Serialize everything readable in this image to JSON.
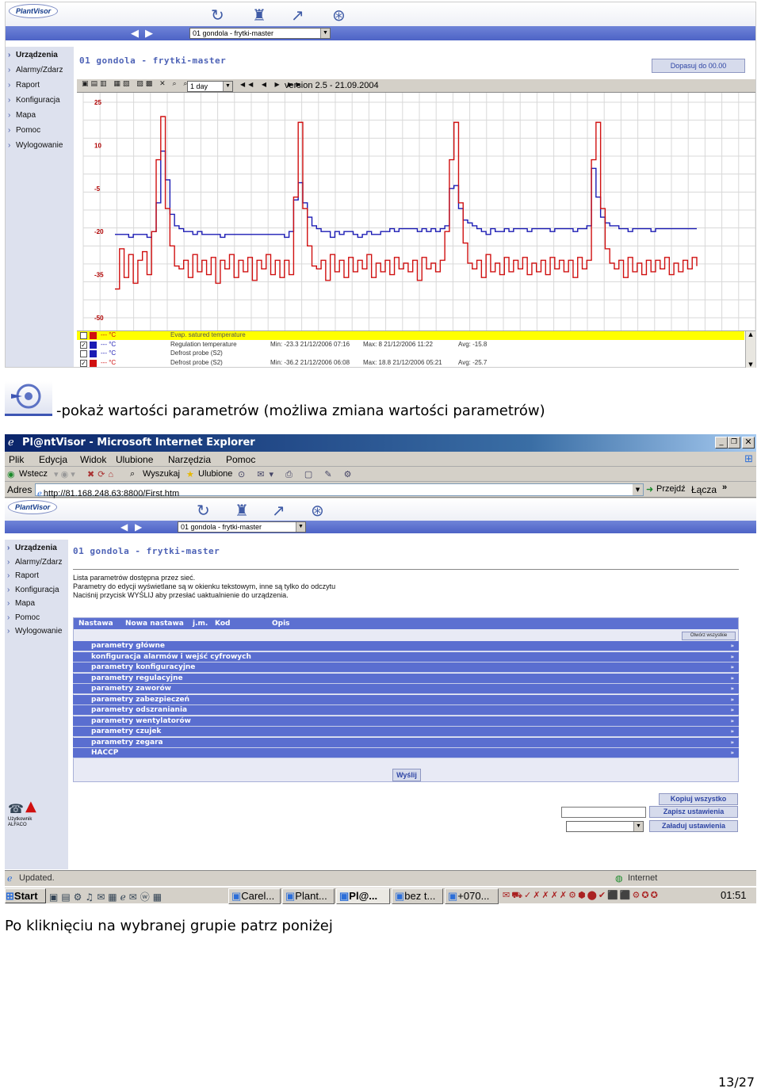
{
  "top_app": {
    "logo": "PlantVisor",
    "device_select": "01 gondola - frytki-master",
    "sidebar": [
      "Urządzenia",
      "Alarmy/Zdarz",
      "Raport",
      "Konfiguracja",
      "Mapa",
      "Pomoc",
      "Wylogowanie"
    ],
    "page_title": "01 gondola - frytki-master",
    "adjust_button": "Dopasuj do 00.00",
    "period_select": "1 day",
    "version": "version 2.5 - 21.09.2004",
    "chart_data": {
      "type": "line",
      "y_ticks": [
        "25",
        "10",
        "-5",
        "-20",
        "-35",
        "-50"
      ],
      "ylim": [
        -50,
        25
      ],
      "grid": true,
      "series": [
        {
          "name": "Regulation temperature",
          "color": "#1b1bb4",
          "values": [
            -21,
            -21,
            -21,
            -22,
            -21,
            -21,
            -21,
            -22,
            -20,
            -10,
            8,
            -2,
            -14,
            -18,
            -19,
            -20,
            -20,
            -21,
            -20,
            -21,
            -21,
            -21,
            -21,
            -22,
            -21,
            -21,
            -21,
            -21,
            -21,
            -21,
            -21,
            -21,
            -21,
            -21,
            -21,
            -21,
            -21,
            -22,
            -20,
            -9,
            -3,
            -10,
            -15,
            -18,
            -19,
            -20,
            -20,
            -22,
            -20,
            -21,
            -20,
            -20,
            -21,
            -22,
            -21,
            -20,
            -21,
            -21,
            -20,
            -20,
            -19,
            -20,
            -19,
            -19,
            -19,
            -19,
            -20,
            -19,
            -20,
            -19,
            -20,
            -19,
            -18,
            -5,
            -4,
            -12,
            -16,
            -17,
            -18,
            -19,
            -20,
            -21,
            -19,
            -20,
            -20,
            -19,
            -20,
            -19,
            -19,
            -19,
            -20,
            -19,
            -19,
            -19,
            -19,
            -20,
            -19,
            -19,
            -19,
            -19,
            -20,
            -19,
            -19,
            -18,
            2,
            -8,
            -15,
            -17,
            -18,
            -18,
            -19,
            -19,
            -20,
            -19,
            -19,
            -19,
            -19,
            -20,
            -19,
            -19,
            -19,
            -19,
            -19,
            -19,
            -19,
            -19,
            -19,
            -19
          ]
        },
        {
          "name": "Defrost probe (S2)",
          "color": "#d01010",
          "values": [
            -40,
            -26,
            -36,
            -28,
            -38,
            -30,
            -27,
            -35,
            -20,
            5,
            20,
            -12,
            -25,
            -32,
            -33,
            -30,
            -36,
            -28,
            -34,
            -30,
            -35,
            -29,
            -38,
            -30,
            -33,
            -28,
            -36,
            -30,
            -34,
            -29,
            -37,
            -30,
            -33,
            -28,
            -35,
            -30,
            -36,
            -30,
            -35,
            -8,
            18,
            -12,
            -25,
            -32,
            -33,
            -30,
            -37,
            -28,
            -34,
            -30,
            -36,
            -29,
            -34,
            -30,
            -33,
            -28,
            -36,
            -31,
            -34,
            -30,
            -35,
            -29,
            -33,
            -31,
            -34,
            -30,
            -37,
            -29,
            -33,
            -31,
            -34,
            -30,
            -20,
            5,
            18,
            -10,
            -24,
            -31,
            -33,
            -30,
            -36,
            -28,
            -34,
            -31,
            -35,
            -29,
            -34,
            -30,
            -33,
            -29,
            -35,
            -31,
            -34,
            -30,
            -35,
            -29,
            -33,
            -30,
            -34,
            -30,
            -36,
            -29,
            -33,
            -30,
            5,
            18,
            -12,
            -26,
            -31,
            -33,
            -30,
            -36,
            -29,
            -34,
            -31,
            -35,
            -30,
            -34,
            -30,
            -33,
            -29,
            -35,
            -31,
            -34,
            -30,
            -33,
            -29,
            -32
          ]
        }
      ]
    },
    "legend": [
      {
        "unit": "--- °C",
        "name": "Evap. satured temperature",
        "color": "#d01010",
        "checked": false,
        "highlight": true,
        "min": "",
        "max": "",
        "avg": ""
      },
      {
        "unit": "--- °C",
        "name": "Regulation temperature",
        "color": "#1b1bb4",
        "checked": true,
        "highlight": false,
        "min": "Min: -23.3   21/12/2006 07:16",
        "max": "Max: 8   21/12/2006 11:22",
        "avg": "Avg: -15.8"
      },
      {
        "unit": "--- °C",
        "name": "Defrost probe (S2)",
        "color": "#1b1bb4",
        "checked": false,
        "highlight": false,
        "min": "",
        "max": "",
        "avg": ""
      },
      {
        "unit": "--- °C",
        "name": "Defrost probe (S2)",
        "color": "#d01010",
        "checked": true,
        "highlight": false,
        "min": "Min: -36.2   21/12/2006 06:08",
        "max": "Max: 18.8   21/12/2006 05:21",
        "avg": "Avg: -25.7"
      }
    ]
  },
  "caption1": "-pokaż wartości parametrów (możliwa zmiana wartości parametrów)",
  "browser": {
    "title": "Pl@ntVisor - Microsoft Internet Explorer",
    "menu": [
      "Plik",
      "Edycja",
      "Widok",
      "Ulubione",
      "Narzędzia",
      "Pomoc"
    ],
    "back": "Wstecz",
    "search": "Wyszukaj",
    "favorites": "Ulubione",
    "address_label": "Adres",
    "address": "http://81.168.248.63:8800/First.htm",
    "go": "Przejdź",
    "links": "Łącza",
    "status": "Updated.",
    "zone": "Internet"
  },
  "param_page": {
    "device_select": "01 gondola - frytki-master",
    "title": "01 gondola - frytki-master",
    "desc": [
      "Lista parametrów dostępna przez sieć.",
      "Parametry do edycji wyświetlane są w okienku tekstowym, inne są tylko do odczytu",
      "Naciśnij przycisk WYŚLIJ aby przesłać uaktualnienie do urządzenia."
    ],
    "columns": [
      "Nastawa",
      "Nowa nastawa",
      "j.m.",
      "Kod",
      "Opis"
    ],
    "open_all": "Otwórz wszystkie",
    "groups": [
      "parametry główne",
      "konfiguracja alarmów i wejść cyfrowych",
      "parametry konfiguracyjne",
      "parametry regulacyjne",
      "parametry zaworów",
      "parametry zabezpieczeń",
      "parametry odszraniania",
      "parametry wentylatorów",
      "parametry czujek",
      "parametry zegara",
      "HACCP"
    ],
    "send": "Wyślij",
    "copy_all": "Kopiuj wszystko",
    "save_settings": "Zapisz ustawienia",
    "load_settings": "Załaduj ustawienia",
    "user_label": "Użytkownik",
    "user_name": "ALFACO"
  },
  "taskbar": {
    "start": "Start",
    "items": [
      "Carel...",
      "Plant...",
      "Pl@...",
      "bez t...",
      "+070..."
    ],
    "clock": "01:51"
  },
  "caption2": "Po kliknięciu na wybranej grupie patrz poniżej",
  "page_number": "13/27"
}
